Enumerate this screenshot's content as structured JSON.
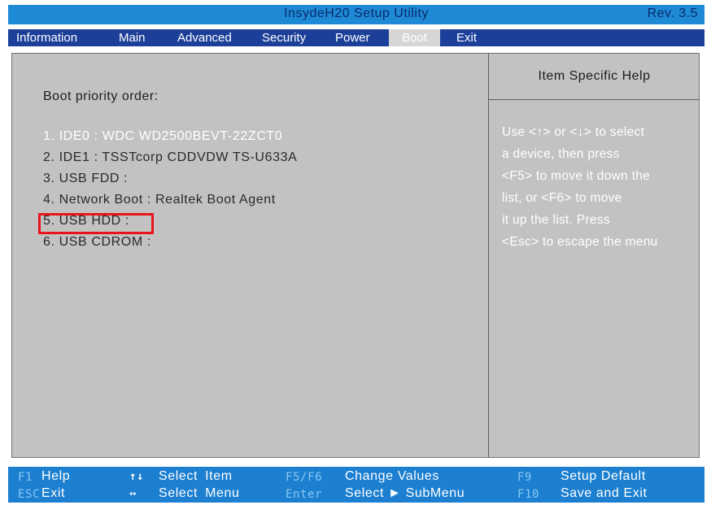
{
  "header": {
    "title": "InsydeH20 Setup Utility",
    "rev": "Rev. 3.5"
  },
  "tabs": [
    {
      "label": "Information",
      "active": false
    },
    {
      "label": "Main",
      "active": false
    },
    {
      "label": "Advanced",
      "active": false
    },
    {
      "label": "Security",
      "active": false
    },
    {
      "label": "Power",
      "active": false
    },
    {
      "label": "Boot",
      "active": true
    },
    {
      "label": "Exit",
      "active": false
    }
  ],
  "main": {
    "section_label": "Boot priority order:",
    "boot_items": [
      "1. IDE0 : WDC WD2500BEVT-22ZCT0",
      "2. IDE1 : TSSTcorp CDDVDW TS-U633A",
      "3. USB FDD :",
      "4. Network Boot : Realtek Boot Agent",
      "5. USB HDD :",
      "6. USB CDROM :"
    ],
    "selected_index": 0,
    "highlighted_index": 4
  },
  "help": {
    "title": "Item Specific Help",
    "lines": [
      "Use <↑> or <↓> to select",
      "a device, then press",
      "<F5> to move it down the",
      "list, or <F6> to move",
      "it up the list. Press",
      "<Esc> to escape the menu"
    ]
  },
  "legend": {
    "f1_key": "F1",
    "f1_label": "Help",
    "updown_key": "↑↓",
    "updown_label": "Select  Item",
    "f5f6_key": "F5/F6",
    "f5f6_label": "Change Values",
    "f9_key": "F9",
    "f9_label": "Setup Default",
    "esc_key": "ESC",
    "esc_label": "Exit",
    "leftright_key": "↔",
    "leftright_label": "Select  Menu",
    "enter_key": "Enter",
    "enter_label": "Select ► SubMenu",
    "f10_key": "F10",
    "f10_label": "Save and Exit"
  },
  "colors": {
    "title_bar": "#1e8ad6",
    "tab_bar": "#1c3f99",
    "panel_bg": "#c2c2c2",
    "highlight_box": "#e8141c",
    "legend_bar": "#1c7fd0"
  }
}
